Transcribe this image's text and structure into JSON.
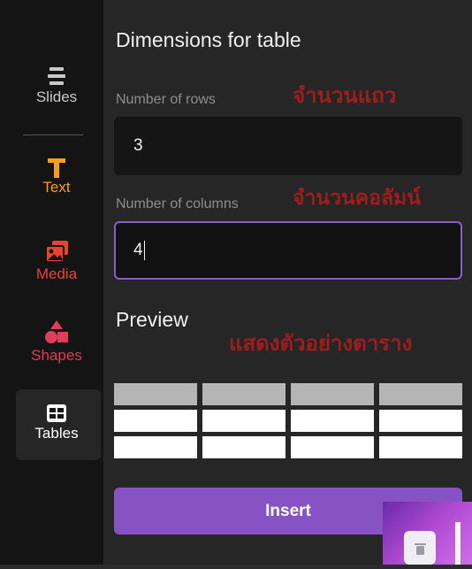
{
  "sidebar": {
    "items": [
      {
        "label": "Slides",
        "icon": "stacked-lines-icon",
        "color": "#c8c8c8"
      },
      {
        "label": "Text",
        "icon": "text-T-icon",
        "color": "#f4a01c"
      },
      {
        "label": "Media",
        "icon": "media-image-icon",
        "color": "#e8432f"
      },
      {
        "label": "Shapes",
        "icon": "shapes-icon",
        "color": "#dd3e59"
      },
      {
        "label": "Tables",
        "icon": "table-grid-icon",
        "color": "#ffffff"
      }
    ],
    "active": "Tables"
  },
  "panel": {
    "title": "Dimensions for table",
    "rows_label": "Number of rows",
    "rows_value": "3",
    "columns_label": "Number of columns",
    "columns_value": "4",
    "preview_label": "Preview",
    "insert_label": "Insert"
  },
  "annotations": {
    "rows": "จำนวนแถว",
    "columns": "จำนวนคอลัมน์",
    "preview": "แสดงตัวอย่างตาราง"
  },
  "preview_table": {
    "rows": 3,
    "columns": 4,
    "header_color": "#b5b5b5",
    "body_color": "#ffffff"
  },
  "colors": {
    "accent": "#8753c4",
    "focus_border": "#8a5ec9",
    "annotation": "#9f1d1d"
  }
}
